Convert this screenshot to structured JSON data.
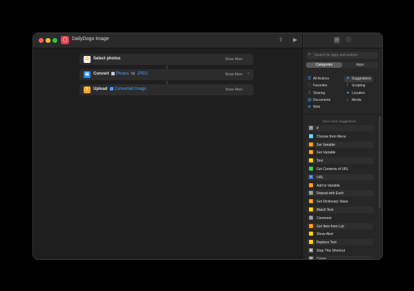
{
  "window": {
    "title": "DailyDogo Image"
  },
  "actions": [
    {
      "label": "Select photos",
      "show_more": "Show More",
      "icon": "photos-icon",
      "color": "#f4a623"
    },
    {
      "verb": "Convert",
      "input": "Photos",
      "joiner": "to",
      "format": "JPEG",
      "show_more": "Show More",
      "close": "×",
      "icon": "image-convert-icon",
      "color": "#1e88e5"
    },
    {
      "verb": "Upload",
      "input": "Converted Image",
      "show_more": "Show More",
      "icon": "upload-icon",
      "color": "#f4a623"
    }
  ],
  "sidebar": {
    "search_placeholder": "Search for apps and actions",
    "segments": [
      "Categories",
      "Apps"
    ],
    "active_segment": "Categories",
    "categories": [
      {
        "label": "All Actions",
        "icon": "list-icon"
      },
      {
        "label": "Suggestions",
        "icon": "sparkle-icon",
        "selected": true
      },
      {
        "label": "Favorites",
        "icon": "heart-icon"
      },
      {
        "label": "Scripting",
        "icon": "scripting-icon"
      },
      {
        "label": "Sharing",
        "icon": "share-icon"
      },
      {
        "label": "Location",
        "icon": "location-icon"
      },
      {
        "label": "Documents",
        "icon": "document-icon"
      },
      {
        "label": "Media",
        "icon": "music-icon"
      },
      {
        "label": "Web",
        "icon": "web-icon"
      }
    ],
    "suggestions_title": "Next Action Suggestions",
    "suggestions": [
      {
        "label": "If",
        "color": "#8e8e93",
        "glyph": "Y"
      },
      {
        "label": "Choose from Menu",
        "color": "#5ac8fa",
        "glyph": "≡"
      },
      {
        "label": "Set Variable",
        "color": "#ff9500",
        "glyph": "x"
      },
      {
        "label": "Get Variable",
        "color": "#ff9500",
        "glyph": "x"
      },
      {
        "label": "Text",
        "color": "#ffcc00",
        "glyph": "≡"
      },
      {
        "label": "Get Contents of URL",
        "color": "#34c759",
        "glyph": "↓"
      },
      {
        "label": "URL",
        "color": "#3a6fd8",
        "glyph": "⊘"
      },
      {
        "label": "Add to Variable",
        "color": "#ff9500",
        "glyph": "x"
      },
      {
        "label": "Repeat with Each",
        "color": "#8e8e93",
        "glyph": "↻"
      },
      {
        "label": "Get Dictionary Value",
        "color": "#ff9500",
        "glyph": "{}"
      },
      {
        "label": "Match Text",
        "color": "#ffcc00",
        "glyph": "≡"
      },
      {
        "label": "Comment",
        "color": "#8e8e93",
        "glyph": "≡"
      },
      {
        "label": "Get Item from List",
        "color": "#ff9500",
        "glyph": "≡"
      },
      {
        "label": "Show Alert",
        "color": "#ffcc00",
        "glyph": "!"
      },
      {
        "label": "Replace Text",
        "color": "#ffcc00",
        "glyph": "≡"
      },
      {
        "label": "Stop This Shortcut",
        "color": "#8e8e93",
        "glyph": "■"
      },
      {
        "label": "Count",
        "color": "#8e8e93",
        "glyph": "#"
      }
    ]
  }
}
